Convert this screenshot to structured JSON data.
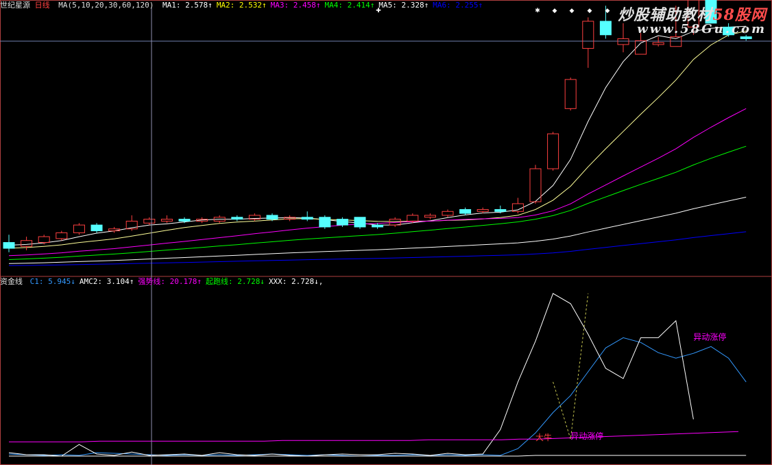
{
  "main_header": {
    "name": "世纪星源",
    "period": "日线",
    "ma_params": "MA(5,10,20,30,60,120)",
    "items": [
      {
        "label": "MA1:",
        "value": "2.578",
        "arrow": "↑",
        "color": "#ffffff"
      },
      {
        "label": "MA2:",
        "value": "2.532",
        "arrow": "↑",
        "color": "#ffff00"
      },
      {
        "label": "MA3:",
        "value": "2.458",
        "arrow": "↑",
        "color": "#ff00ff"
      },
      {
        "label": "MA4:",
        "value": "2.414",
        "arrow": "↑",
        "color": "#00ff00"
      },
      {
        "label": "MA5:",
        "value": "2.328",
        "arrow": "↑",
        "color": "#ffffff"
      },
      {
        "label": "MA6:",
        "value": "2.255",
        "arrow": "↑",
        "color": "#0000ff"
      }
    ]
  },
  "indicator_header": {
    "name": "资金线",
    "items": [
      {
        "label": "C1:",
        "value": "5.945",
        "arrow": "↓",
        "color": "#3399ff"
      },
      {
        "label": "AMC2:",
        "value": "3.104",
        "arrow": "↑",
        "color": "#ffffff"
      },
      {
        "label": "强势线:",
        "value": "20.178",
        "arrow": "↑",
        "color": "#ff00ff"
      },
      {
        "label": "起跑线:",
        "value": "2.728",
        "arrow": "↓",
        "color": "#00ff00"
      },
      {
        "label": "XXX:",
        "value": "2.728",
        "arrow": "↓,",
        "color": "#ffffff"
      }
    ]
  },
  "watermark": {
    "line1_a": "炒股辅助教材",
    "line1_b": "58股网",
    "line2": "www.58Gu.com"
  },
  "colors": {
    "up": "#ff4040",
    "down": "#55ffff",
    "ma1": "#ffffff",
    "ma2": "#ffff99",
    "ma3": "#ff00ff",
    "ma4": "#00ff00",
    "ma5": "#ffffff",
    "ma6": "#0000ff",
    "c1": "#3399ff",
    "amc2": "#ffffff",
    "strong": "#ff00ff",
    "start": "#ffffff",
    "frame": "#b04040"
  },
  "chart_data": [
    {
      "type": "candlestick",
      "title": "世纪星源 日线",
      "ylim": [
        1.6,
        2.95
      ],
      "candles": [
        [
          1.75,
          1.72,
          1.79,
          1.7
        ],
        [
          1.73,
          1.76,
          1.78,
          1.71
        ],
        [
          1.75,
          1.78,
          1.79,
          1.74
        ],
        [
          1.77,
          1.8,
          1.81,
          1.76
        ],
        [
          1.8,
          1.84,
          1.85,
          1.79
        ],
        [
          1.84,
          1.81,
          1.85,
          1.8
        ],
        [
          1.81,
          1.82,
          1.83,
          1.8
        ],
        [
          1.82,
          1.86,
          1.89,
          1.81
        ],
        [
          1.85,
          1.87,
          1.88,
          1.84
        ],
        [
          1.86,
          1.87,
          1.89,
          1.85
        ],
        [
          1.87,
          1.86,
          1.88,
          1.85
        ],
        [
          1.86,
          1.87,
          1.88,
          1.85
        ],
        [
          1.86,
          1.88,
          1.89,
          1.85
        ],
        [
          1.88,
          1.87,
          1.89,
          1.86
        ],
        [
          1.87,
          1.89,
          1.9,
          1.86
        ],
        [
          1.89,
          1.87,
          1.9,
          1.86
        ],
        [
          1.87,
          1.88,
          1.89,
          1.86
        ],
        [
          1.88,
          1.87,
          1.91,
          1.86
        ],
        [
          1.88,
          1.83,
          1.89,
          1.82
        ],
        [
          1.87,
          1.84,
          1.88,
          1.83
        ],
        [
          1.88,
          1.83,
          1.88,
          1.82
        ],
        [
          1.84,
          1.83,
          1.85,
          1.82
        ],
        [
          1.84,
          1.87,
          1.88,
          1.83
        ],
        [
          1.86,
          1.89,
          1.9,
          1.85
        ],
        [
          1.88,
          1.89,
          1.9,
          1.87
        ],
        [
          1.89,
          1.91,
          1.92,
          1.88
        ],
        [
          1.92,
          1.9,
          1.93,
          1.89
        ],
        [
          1.91,
          1.92,
          1.93,
          1.9
        ],
        [
          1.92,
          1.91,
          1.94,
          1.9
        ],
        [
          1.91,
          1.95,
          1.98,
          1.9
        ],
        [
          1.96,
          2.13,
          2.15,
          1.95
        ],
        [
          2.13,
          2.31,
          2.32,
          2.12
        ],
        [
          2.44,
          2.59,
          2.6,
          2.43
        ],
        [
          2.75,
          2.89,
          2.91,
          2.65
        ],
        [
          2.89,
          2.82,
          2.97,
          2.8
        ],
        [
          2.77,
          2.8,
          2.88,
          2.73
        ],
        [
          2.72,
          2.79,
          2.83,
          2.72
        ],
        [
          2.77,
          2.78,
          2.81,
          2.76
        ],
        [
          2.76,
          2.81,
          2.97,
          2.76
        ],
        [
          2.86,
          3.01,
          3.03,
          2.82
        ],
        [
          3.01,
          2.88,
          3.06,
          2.88
        ],
        [
          2.86,
          2.82,
          2.88,
          2.81
        ],
        [
          2.81,
          2.8,
          2.82,
          2.79
        ]
      ]
    },
    {
      "type": "line",
      "title": "资金线",
      "ylim": [
        0,
        25
      ],
      "x": [
        0,
        1,
        2,
        3,
        4,
        5,
        6,
        7,
        8,
        9,
        10,
        11,
        12,
        13,
        14,
        15,
        16,
        17,
        18,
        19,
        20,
        21,
        22,
        23,
        24,
        25,
        26,
        27,
        28,
        29,
        30,
        31,
        32,
        33,
        34,
        35,
        36,
        37,
        38,
        39,
        40,
        41,
        42
      ],
      "series": [
        {
          "name": "AMC2",
          "values": [
            0.4,
            0.3,
            0.2,
            0.3,
            0.2,
            0.6,
            0.5,
            0.4,
            0.3,
            0.2,
            0.3,
            0.2,
            0.3,
            0.2,
            0.3,
            0.4,
            0.3,
            0.2,
            0.3,
            0.2,
            0.1,
            0.2,
            0.2,
            0.3,
            0.2,
            0.3,
            0.2,
            0.3,
            0.2,
            1.2,
            3.5,
            6.5,
            9.0,
            12.5,
            16.0,
            17.5,
            16.8,
            15.3,
            14.5,
            15.2,
            16.2,
            14.5,
            11.0
          ]
        },
        {
          "name": "XXX",
          "values": [
            0.6,
            0.3,
            0.3,
            0.1,
            1.8,
            0.4,
            0.2,
            0.7,
            0.2,
            0.3,
            0.4,
            0.2,
            0.6,
            0.3,
            0.2,
            0.4,
            0.2,
            0.1,
            0.3,
            0.4,
            0.3,
            0.3,
            0.5,
            0.4,
            0.2,
            0.5,
            0.3,
            0.4,
            4.0,
            11.0,
            17.0,
            24.0,
            22.5,
            18.0,
            13.0,
            11.5,
            17.5,
            17.5,
            20.0,
            5.5
          ]
        },
        {
          "name": "强势线",
          "values": [
            2.2,
            2.2,
            2.2,
            2.2,
            2.2,
            2.3,
            2.3,
            2.3,
            2.3,
            2.3,
            2.3,
            2.3,
            2.3,
            2.3,
            2.3,
            2.4,
            2.4,
            2.4,
            2.4,
            2.4,
            2.4,
            2.4,
            2.4,
            2.5,
            2.5,
            2.5,
            2.5,
            2.5,
            2.6,
            2.6,
            2.7,
            2.8,
            2.9,
            3.0,
            3.1,
            3.2,
            3.3,
            3.4,
            3.5,
            3.6,
            3.7
          ]
        },
        {
          "name": "起跑线",
          "values": [
            0.1,
            0.1,
            0.1,
            0.1,
            0.1,
            0.1,
            0.1,
            0.1,
            0.1,
            0.1,
            0.1,
            0.1,
            0.1,
            0.1,
            0.1,
            0.1,
            0.1,
            0.1,
            0.1,
            0.1,
            0.1,
            0.1,
            0.1,
            0.1,
            0.1,
            0.1,
            0.1,
            0.1,
            0.1,
            0.1,
            0.2,
            0.2,
            0.2,
            0.2,
            0.2,
            0.2,
            0.2,
            0.2,
            0.2,
            0.2,
            0.2,
            0.2,
            0.2
          ]
        }
      ],
      "annotations": [
        {
          "text": "大牛",
          "x": 30,
          "y": 2.4,
          "color": "#ff4040"
        },
        {
          "text": "异动涨停",
          "x": 32,
          "y": 2.6,
          "color": "#ff00ff"
        },
        {
          "text": "异动涨停",
          "x": 39,
          "y": 17.2,
          "color": "#ff00ff"
        }
      ]
    }
  ]
}
